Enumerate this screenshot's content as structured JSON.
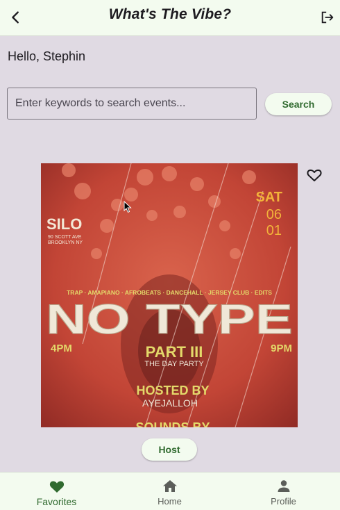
{
  "appbar": {
    "title": "What's The Vibe?"
  },
  "greeting": "Hello, Stephin",
  "search": {
    "placeholder": "Enter keywords to search events...",
    "button_label": "Search"
  },
  "event": {
    "venue": "SILO",
    "address_line1": "90 SCOTT AVE",
    "address_line2": "BROOKLYN NY",
    "day": "SAT",
    "month": "06",
    "date": "01",
    "genres": "TRAP · AMAPIANO · AFROBEATS · DANCEHALL · JERSEY CLUB · EDITS",
    "name": "NO TYPE",
    "start_time": "4PM",
    "end_time": "9PM",
    "part": "PART III",
    "subtitle": "THE DAY PARTY",
    "hosted_by": "HOSTED BY",
    "host_name": "AYEJALLOH",
    "sounds_by": "SOUNDS BY"
  },
  "host_button": "Host",
  "nav": [
    {
      "label": "Favorites",
      "icon": "heart-icon"
    },
    {
      "label": "Home",
      "icon": "home-icon"
    },
    {
      "label": "Profile",
      "icon": "person-icon"
    }
  ],
  "colors": {
    "accent": "#306a2f",
    "surface": "#f3fbef",
    "background": "#e0dae3"
  }
}
